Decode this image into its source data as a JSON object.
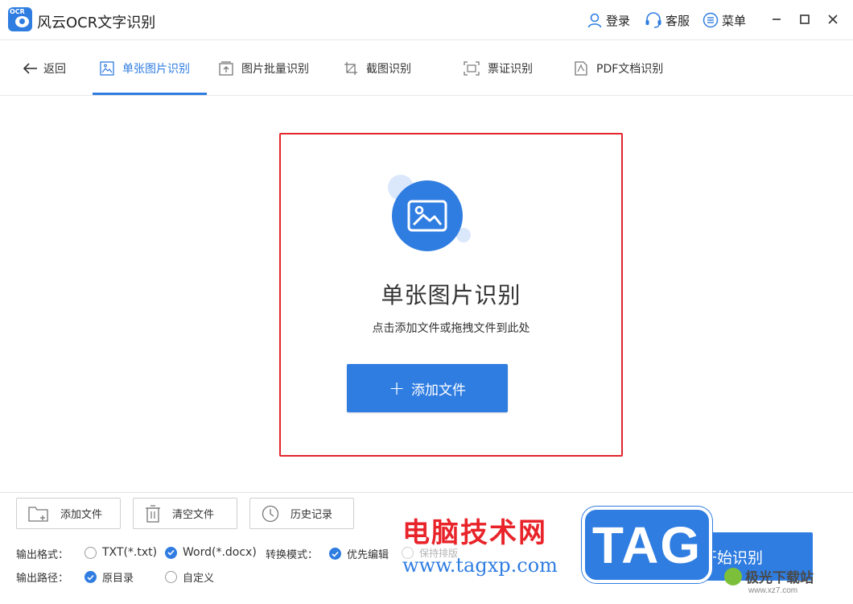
{
  "app": {
    "logo_text": "OCR",
    "title": "风云OCR文字识别"
  },
  "header": {
    "login": "登录",
    "support": "客服",
    "menu": "菜单"
  },
  "tabbar": {
    "back": "返回",
    "tabs": [
      {
        "label": "单张图片识别",
        "active": true
      },
      {
        "label": "图片批量识别",
        "active": false
      },
      {
        "label": "截图识别",
        "active": false
      },
      {
        "label": "票证识别",
        "active": false
      },
      {
        "label": "PDF文档识别",
        "active": false
      }
    ]
  },
  "dropzone": {
    "title": "单张图片识别",
    "subtitle": "点击添加文件或拖拽文件到此处",
    "add_button": "添加文件"
  },
  "bottom": {
    "buttons": {
      "add_file": "添加文件",
      "clear_files": "清空文件",
      "history": "历史记录"
    },
    "output_format_label": "输出格式：",
    "output_format_options": [
      {
        "label": "TXT(*.txt)",
        "checked": false
      },
      {
        "label": "Word(*.docx)",
        "checked": true
      }
    ],
    "convert_mode_label": "转换模式：",
    "convert_mode_options": [
      {
        "label": "优先编辑",
        "checked": true,
        "disabled": false
      },
      {
        "label": "保持排版",
        "checked": false,
        "disabled": true
      }
    ],
    "output_path_label": "输出路径：",
    "output_path_options": [
      {
        "label": "原目录",
        "checked": true
      },
      {
        "label": "自定义",
        "checked": false
      }
    ],
    "start_button": "开始识别"
  },
  "watermark": {
    "cn_text": "电脑技术网",
    "url": "www.tagxp.com",
    "tag": "TAG",
    "site": "极光下载站",
    "site_url": "www.xz7.com"
  },
  "colors": {
    "accent": "#2f7de1",
    "dropzone_border": "#e2262c",
    "watermark_red": "#e8242a"
  }
}
